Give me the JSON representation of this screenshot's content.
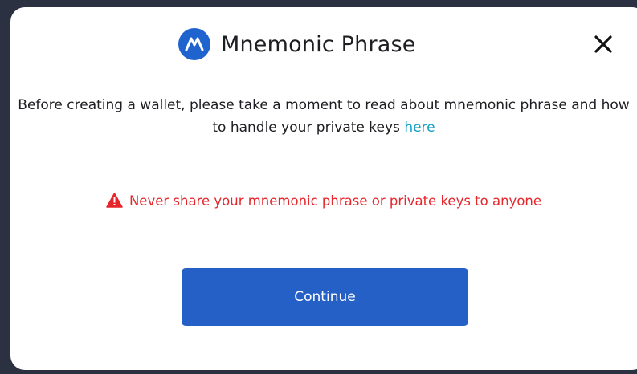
{
  "modal": {
    "title": "Mnemonic Phrase",
    "logo_icon": "mnemonic-logo-icon",
    "close_icon": "close-icon",
    "intro_text": "Before creating a wallet, please take a moment to read about mnemonic phrase and how to handle your private keys",
    "intro_link_label": "here",
    "warning_icon": "warning-triangle-icon",
    "warning_text": "Never share your mnemonic phrase or private keys to anyone",
    "continue_label": "Continue"
  },
  "colors": {
    "brand": "#1f63cf",
    "button": "#2460c6",
    "link": "#13a0c2",
    "warning": "#e5262b",
    "backdrop": "#2b3140"
  }
}
